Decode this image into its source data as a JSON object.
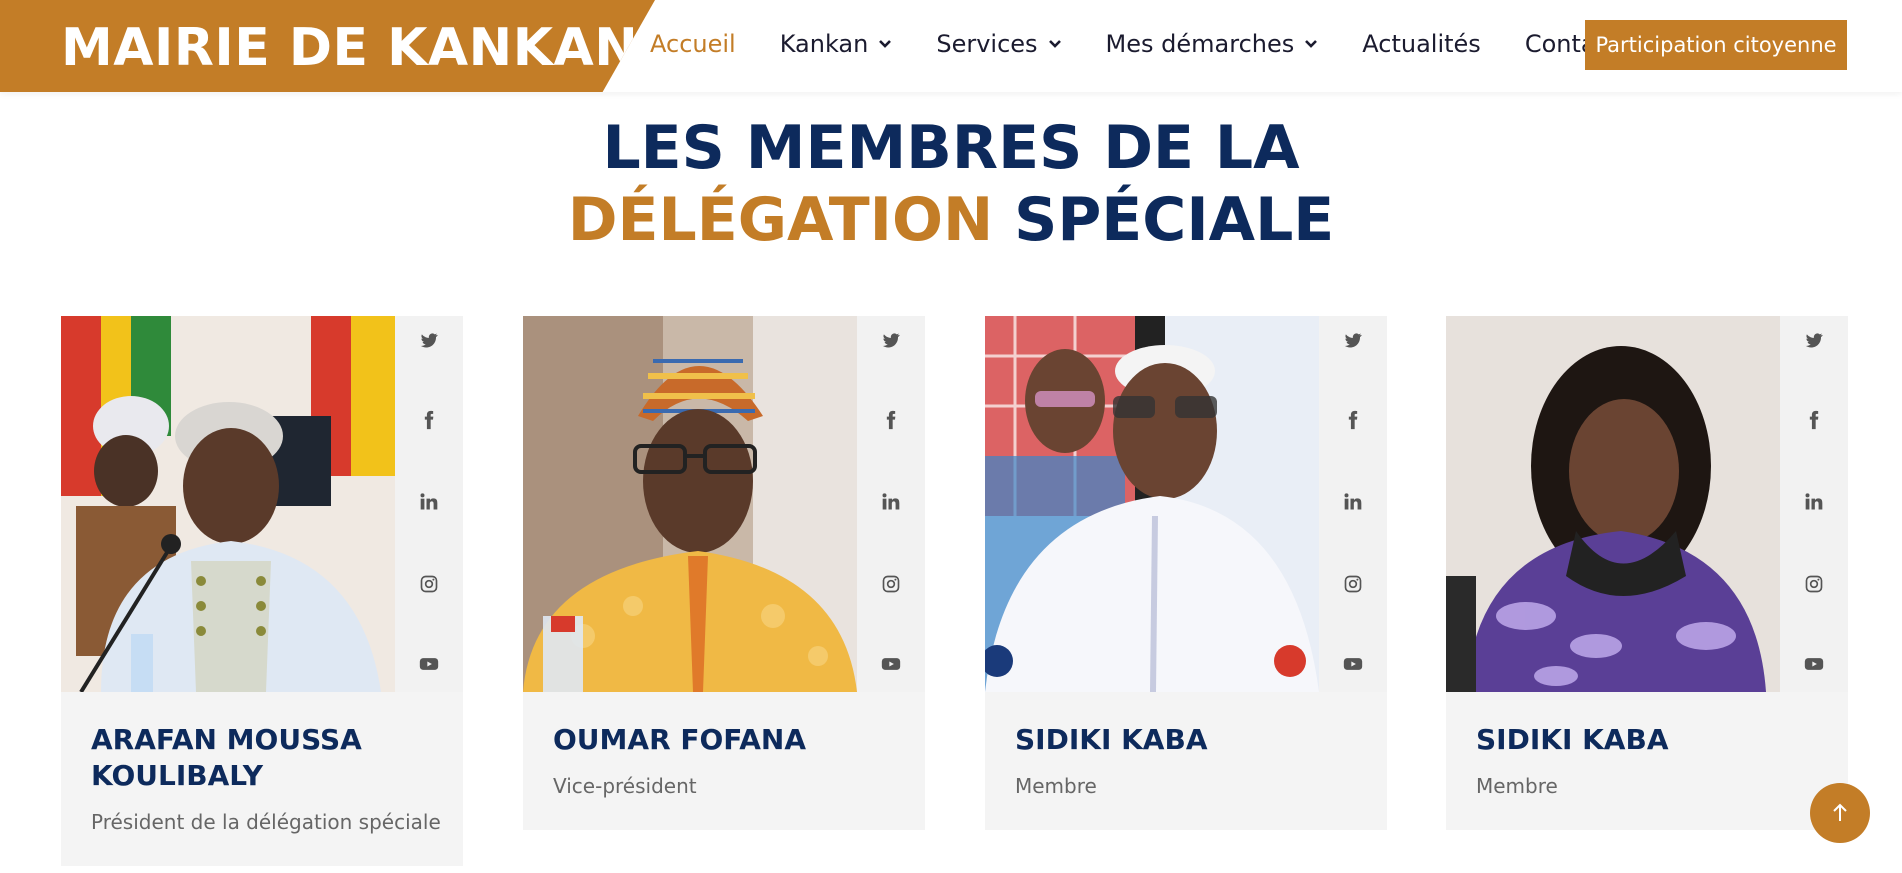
{
  "brand": {
    "name": "MAIRIE DE KANKAN"
  },
  "nav": {
    "items": [
      {
        "label": "Accueil",
        "active": true,
        "dropdown": false
      },
      {
        "label": "Kankan",
        "active": false,
        "dropdown": true
      },
      {
        "label": "Services",
        "active": false,
        "dropdown": true
      },
      {
        "label": "Mes démarches",
        "active": false,
        "dropdown": true
      },
      {
        "label": "Actualités",
        "active": false,
        "dropdown": false
      },
      {
        "label": "Contact",
        "active": false,
        "dropdown": false
      }
    ],
    "cta": "Participation citoyenne"
  },
  "section": {
    "title_line1": "LES MEMBRES DE LA",
    "title_accent": "DÉLÉGATION",
    "title_rest": " SPÉCIALE"
  },
  "members": [
    {
      "name": "ARAFAN MOUSSA KOULIBALY",
      "role": "Président de la délégation spéciale"
    },
    {
      "name": "OUMAR FOFANA",
      "role": "Vice-président"
    },
    {
      "name": "SIDIKI KABA",
      "role": "Membre"
    },
    {
      "name": "SIDIKI KABA",
      "role": "Membre"
    }
  ],
  "social_icons": [
    "twitter-icon",
    "facebook-icon",
    "linkedin-icon",
    "instagram-icon",
    "youtube-icon"
  ],
  "colors": {
    "accent": "#c37d27",
    "navy": "#0d2a5c"
  }
}
